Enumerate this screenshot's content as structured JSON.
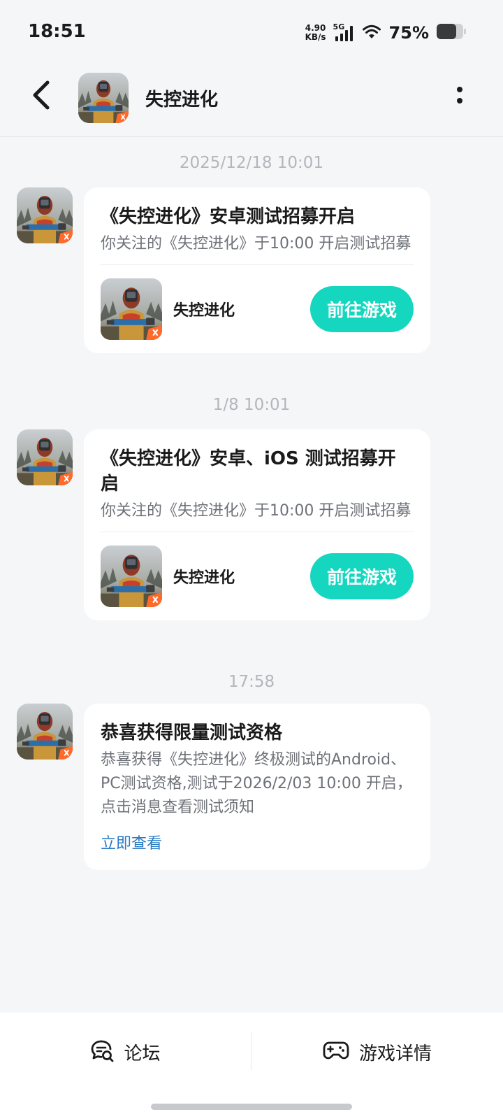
{
  "status_bar": {
    "time": "18:51",
    "net_speed_value": "4.90",
    "net_speed_unit": "KB/s",
    "network_type": "5G",
    "battery": "75%"
  },
  "header": {
    "title": "失控进化"
  },
  "messages": [
    {
      "time": "2025/12/18  10:01",
      "title": "《失控进化》安卓测试招募开启",
      "desc": "你关注的《失控进化》于10:00 开启测试招募",
      "game_name": "失控进化",
      "button": "前往游戏"
    },
    {
      "time": "1/8  10:01",
      "title": "《失控进化》安卓、iOS 测试招募开启",
      "desc": "你关注的《失控进化》于10:00 开启测试招募",
      "game_name": "失控进化",
      "button": "前往游戏"
    },
    {
      "time": "17:58",
      "title": "恭喜获得限量测试资格",
      "desc": "恭喜获得《失控进化》终极测试的Android、PC测试资格,测试于2026/2/03 10:00 开启，点击消息查看测试须知",
      "link": "立即查看"
    }
  ],
  "bottom_bar": {
    "forum_label": "论坛",
    "game_detail_label": "游戏详情"
  },
  "colors": {
    "accent": "#15d6bf",
    "link": "#2a7bc4",
    "background": "#f5f6f8"
  },
  "icons": [
    "back-icon",
    "more-icon",
    "wifi-icon",
    "signal-icon",
    "battery-icon",
    "forum-icon",
    "gamepad-icon"
  ]
}
